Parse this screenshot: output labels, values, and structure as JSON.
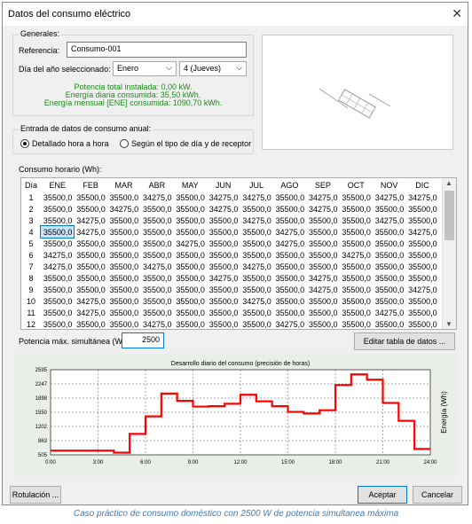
{
  "window": {
    "title": "Datos del consumo eléctrico"
  },
  "generales": {
    "legend": "Generales:",
    "referencia_label": "Referencia:",
    "referencia_value": "Consumo-001",
    "dia_label": "Día del año seleccionado:",
    "mes_value": "Enero",
    "dia_value": "4 (Jueves)",
    "info_lines": [
      "Potencia total instalada: 0,00 kW.",
      "Energía diaria consumida: 35,50 kWh.",
      "Energía mensual [ENE] consumida: 1090,70 kWh."
    ]
  },
  "entrada": {
    "legend": "Entrada de datos de consumo anual:",
    "option_1": "Detallado hora a hora",
    "option_2": "Según el tipo de día y de receptor",
    "selected": 1
  },
  "consumo": {
    "legend": "Consumo horario (Wh):",
    "headers": [
      "Día",
      "ENE",
      "FEB",
      "MAR",
      "ABR",
      "MAY",
      "JUN",
      "JUL",
      "AGO",
      "SEP",
      "OCT",
      "NOV",
      "DIC"
    ],
    "rows": [
      [
        "1",
        "35500,0",
        "35500,0",
        "35500,0",
        "34275,0",
        "35500,0",
        "34275,0",
        "34275,0",
        "35500,0",
        "34275,0",
        "35500,0",
        "34275,0",
        "34275,0"
      ],
      [
        "2",
        "35500,0",
        "35500,0",
        "34275,0",
        "35500,0",
        "35500,0",
        "34275,0",
        "35500,0",
        "35500,0",
        "34275,0",
        "35500,0",
        "35500,0",
        "35500,0"
      ],
      [
        "3",
        "35500,0",
        "34275,0",
        "35500,0",
        "35500,0",
        "35500,0",
        "35500,0",
        "34275,0",
        "35500,0",
        "35500,0",
        "35500,0",
        "34275,0",
        "35500,0"
      ],
      [
        "4",
        "35500,0",
        "34275,0",
        "35500,0",
        "35500,0",
        "35500,0",
        "35500,0",
        "35500,0",
        "34275,0",
        "35500,0",
        "35500,0",
        "35500,0",
        "34275,0"
      ],
      [
        "5",
        "35500,0",
        "35500,0",
        "35500,0",
        "35500,0",
        "34275,0",
        "35500,0",
        "35500,0",
        "34275,0",
        "35500,0",
        "35500,0",
        "35500,0",
        "35500,0"
      ],
      [
        "6",
        "34275,0",
        "35500,0",
        "35500,0",
        "35500,0",
        "35500,0",
        "35500,0",
        "35500,0",
        "35500,0",
        "35500,0",
        "34275,0",
        "35500,0",
        "35500,0"
      ],
      [
        "7",
        "34275,0",
        "35500,0",
        "35500,0",
        "34275,0",
        "35500,0",
        "35500,0",
        "34275,0",
        "35500,0",
        "35500,0",
        "35500,0",
        "35500,0",
        "35500,0"
      ],
      [
        "8",
        "35500,0",
        "35500,0",
        "35500,0",
        "35500,0",
        "35500,0",
        "34275,0",
        "35500,0",
        "35500,0",
        "34275,0",
        "35500,0",
        "35500,0",
        "35500,0"
      ],
      [
        "9",
        "35500,0",
        "35500,0",
        "35500,0",
        "35500,0",
        "35500,0",
        "35500,0",
        "35500,0",
        "35500,0",
        "34275,0",
        "35500,0",
        "35500,0",
        "34275,0"
      ],
      [
        "10",
        "35500,0",
        "34275,0",
        "35500,0",
        "35500,0",
        "35500,0",
        "35500,0",
        "34275,0",
        "35500,0",
        "35500,0",
        "35500,0",
        "35500,0",
        "35500,0"
      ],
      [
        "11",
        "35500,0",
        "34275,0",
        "35500,0",
        "35500,0",
        "35500,0",
        "35500,0",
        "35500,0",
        "35500,0",
        "35500,0",
        "35500,0",
        "34275,0",
        "35500,0"
      ],
      [
        "12",
        "35500,0",
        "35500,0",
        "35500,0",
        "34275,0",
        "35500,0",
        "35500,0",
        "35500,0",
        "34275,0",
        "35500,0",
        "35500,0",
        "35500,0",
        "35500,0"
      ]
    ],
    "selected_cell": {
      "row": 3,
      "col": 1
    },
    "potencia_label": "Potencia máx. simultánea (W):",
    "potencia_value": "2500",
    "editar_button": "Editar tabla de datos ..."
  },
  "chart_data": {
    "type": "line",
    "step": true,
    "title": "Desarrollo diario del consumo (precisión de horas)",
    "xlabel": "",
    "ylabel": "Energía (Wh)",
    "x": [
      0,
      1,
      2,
      3,
      4,
      5,
      6,
      7,
      8,
      9,
      10,
      11,
      12,
      13,
      14,
      15,
      16,
      17,
      18,
      19,
      20,
      21,
      22,
      23
    ],
    "values": [
      608,
      608,
      608,
      608,
      560,
      1020,
      1450,
      2010,
      1830,
      1690,
      1700,
      1760,
      1980,
      1820,
      1700,
      1560,
      1520,
      1600,
      2220,
      2480,
      2350,
      1780,
      1340,
      650
    ],
    "x_ticks": [
      "0:00",
      "3:00",
      "6:00",
      "9:00",
      "12:00",
      "15:00",
      "18:00",
      "21:00",
      "24:00"
    ],
    "y_ticks": [
      "505",
      "863",
      "1202",
      "1550",
      "1898",
      "2247",
      "2595"
    ],
    "xlim": [
      0,
      24
    ],
    "ylim": [
      505,
      2595
    ],
    "grid": true,
    "line_color": "#ff0000"
  },
  "footer": {
    "rotulacion_button": "Rotulación ...",
    "aceptar_button": "Aceptar",
    "cancelar_button": "Cancelar"
  },
  "caption": "Caso práctico de consumo doméstico con 2500 W de potencia simultanea máxima"
}
